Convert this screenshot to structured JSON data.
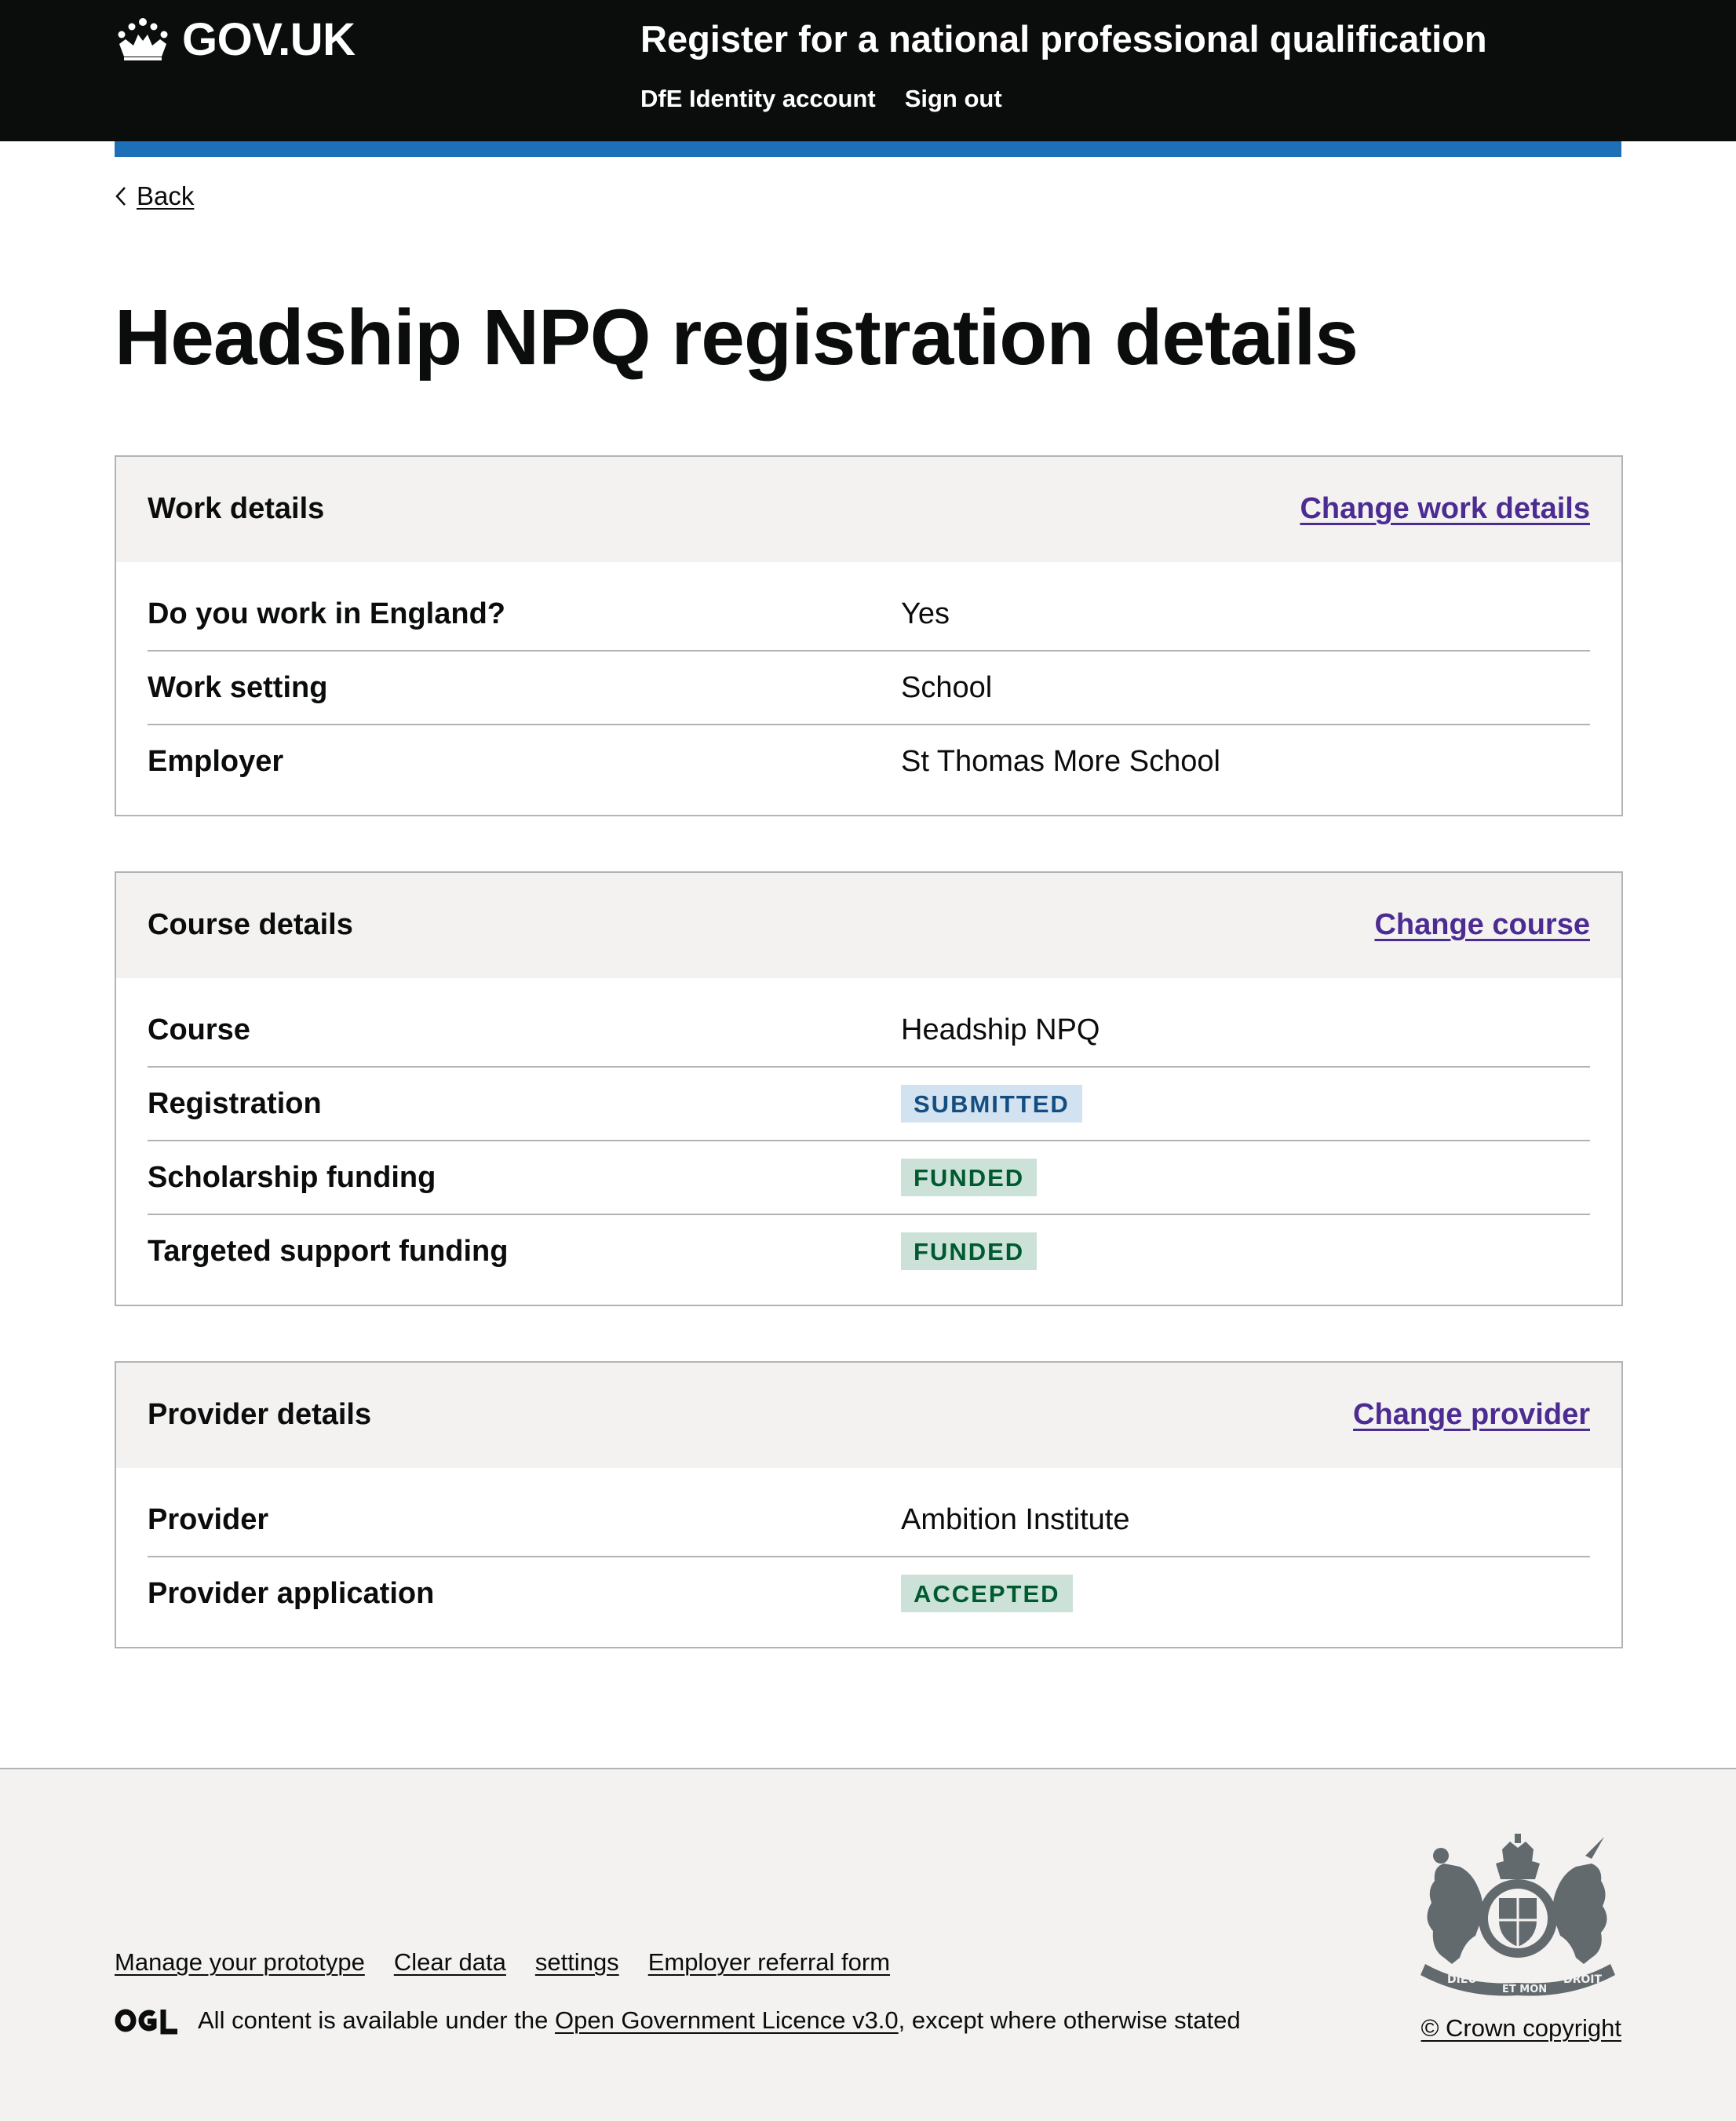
{
  "header": {
    "logo_text": "GOV.UK",
    "service_name": "Register for a national professional qualification",
    "nav": [
      "DfE Identity account",
      "Sign out"
    ]
  },
  "back_link": "Back",
  "page_title": "Headship NPQ registration details",
  "cards": {
    "work": {
      "title": "Work details",
      "action": "Change work details",
      "rows": [
        {
          "key": "Do you work in England?",
          "value": "Yes"
        },
        {
          "key": "Work setting",
          "value": "School"
        },
        {
          "key": "Employer",
          "value": "St Thomas More School"
        }
      ]
    },
    "course": {
      "title": "Course details",
      "action": "Change course",
      "rows": [
        {
          "key": "Course",
          "value": "Headship NPQ"
        },
        {
          "key": "Registration",
          "tag": "SUBMITTED"
        },
        {
          "key": "Scholarship funding",
          "tag": "FUNDED"
        },
        {
          "key": "Targeted support funding",
          "tag": "FUNDED"
        }
      ]
    },
    "provider": {
      "title": "Provider details",
      "action": "Change provider",
      "rows": [
        {
          "key": "Provider",
          "value": "Ambition Institute"
        },
        {
          "key": "Provider application",
          "tag": "ACCEPTED"
        }
      ]
    }
  },
  "footer": {
    "links": [
      "Manage your prototype",
      "Clear data",
      "settings",
      "Employer referral form"
    ],
    "licence_prefix": "All content is available under the",
    "licence_link": "Open Government Licence v3.0",
    "licence_suffix": ", except where otherwise stated",
    "copyright": "© Crown copyright",
    "crest_motto_left": "DIEU",
    "crest_motto_mid": "ET MON",
    "crest_motto_right": "DROIT"
  },
  "colors": {
    "header_bg": "#0b0c0c",
    "brand_blue": "#1d70b8",
    "link_visited": "#4c2c92",
    "tag_blue_bg": "#d2e2f1",
    "tag_blue_text": "#144e81",
    "tag_green_bg": "#cce2d8",
    "tag_green_text": "#005a30",
    "footer_bg": "#f3f2f1"
  }
}
